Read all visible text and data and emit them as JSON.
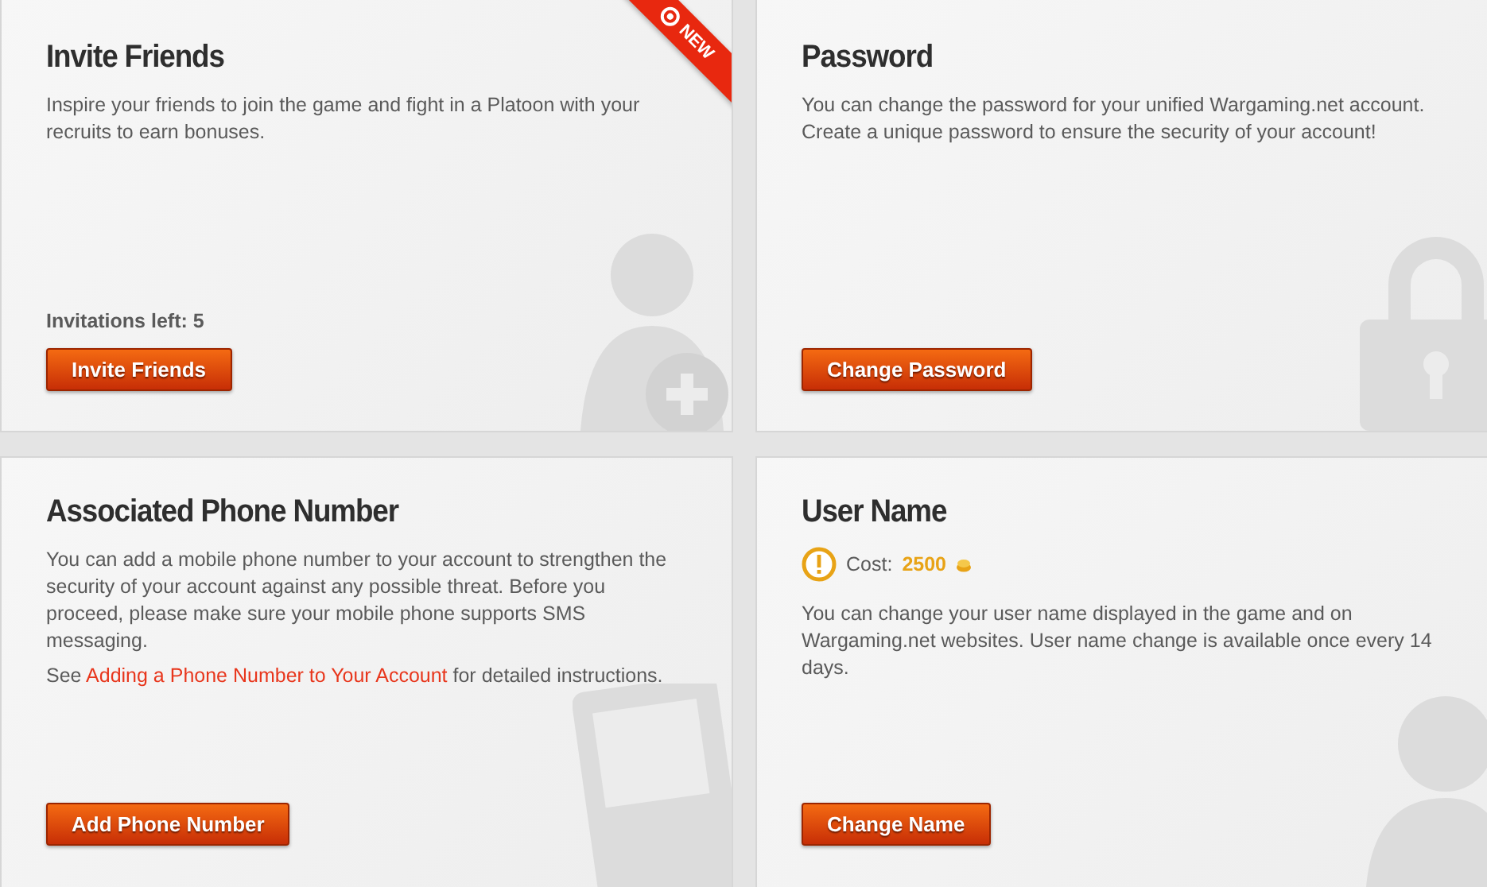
{
  "cards": [
    {
      "kind": "invite",
      "title": "Invite Friends",
      "ribbon": "NEW",
      "paragraphs": [
        [
          {
            "text": "Inspire your friends to join the game and fight in a Platoon with your recruits to earn bonuses."
          }
        ]
      ],
      "note": "Invitations left: 5",
      "button": "Invite Friends"
    },
    {
      "kind": "password",
      "title": "Password",
      "paragraphs": [
        [
          {
            "text": "You can change the password for your unified Wargaming.net account. Create a unique password to ensure the security of your account!"
          }
        ]
      ],
      "button": "Change Password"
    },
    {
      "kind": "phone",
      "title": "Associated Phone Number",
      "paragraphs": [
        [
          {
            "text": "You can add a mobile phone number to your account to strengthen the security of your account against any possible threat. Before you proceed, please make sure your mobile phone supports SMS messaging."
          }
        ],
        [
          {
            "text": "See "
          },
          {
            "text": "Adding a Phone Number to Your Account",
            "link": true
          },
          {
            "text": " for detailed instructions."
          }
        ]
      ],
      "button": "Add Phone Number"
    },
    {
      "kind": "username",
      "title": "User Name",
      "cost": {
        "label": "Cost:",
        "amount": "2500"
      },
      "paragraphs": [
        [
          {
            "text": "You can change your user name displayed in the game and on Wargaming.net websites. User name change is available once every 14 days."
          }
        ]
      ],
      "button": "Change Name"
    }
  ]
}
